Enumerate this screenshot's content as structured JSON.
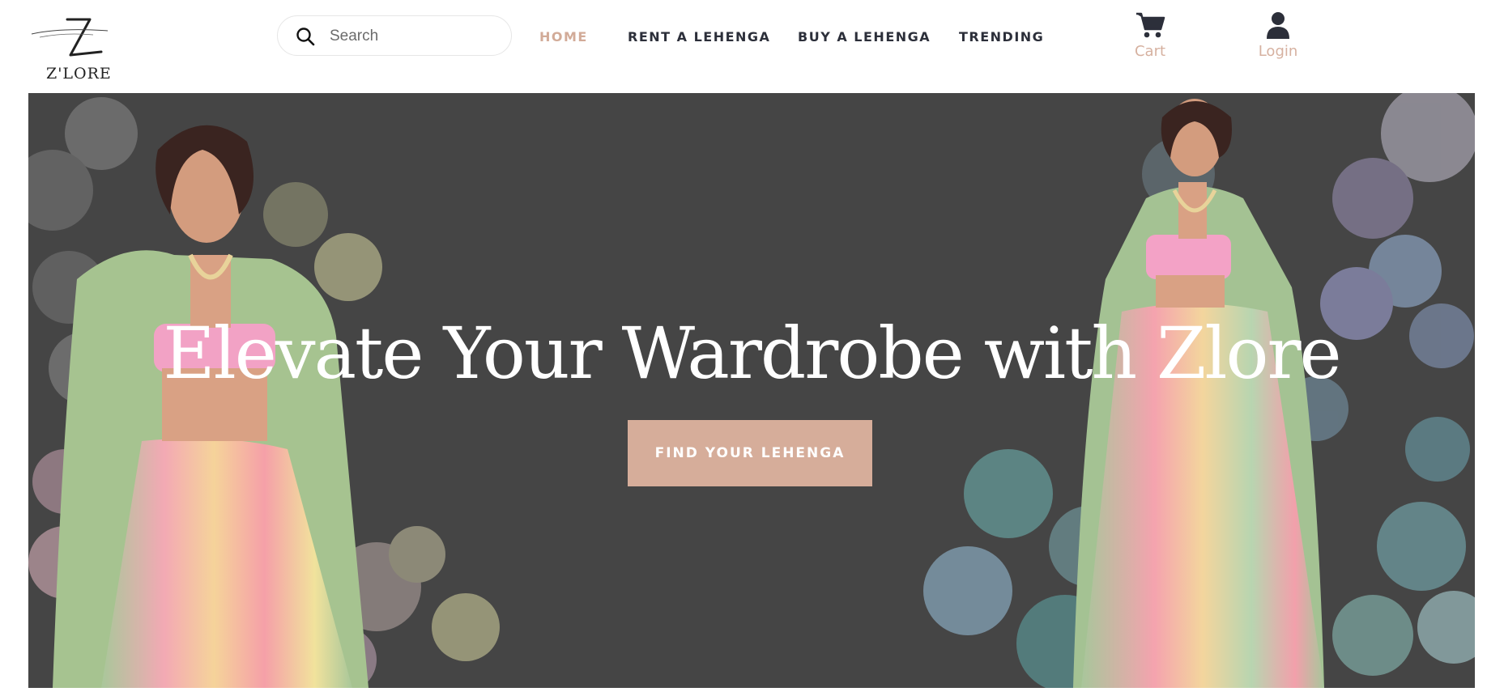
{
  "brand": {
    "name": "Z'LORE",
    "mark": "Z"
  },
  "search": {
    "placeholder": "Search"
  },
  "nav": {
    "items": [
      {
        "label": "HOME",
        "active": true
      },
      {
        "label": "RENT A LEHENGA",
        "active": false
      },
      {
        "label": "BUY A LEHENGA",
        "active": false
      },
      {
        "label": "TRENDING",
        "active": false
      }
    ]
  },
  "header_actions": {
    "cart": {
      "label": "Cart",
      "icon": "cart-icon"
    },
    "login": {
      "label": "Login",
      "icon": "user-icon"
    }
  },
  "hero": {
    "title": "Elevate Your Wardrobe with Zlore",
    "cta_label": "FIND YOUR LEHENGA",
    "images": [
      "model-left-lehenga-image",
      "model-right-lehenga-image"
    ]
  },
  "colors": {
    "accent": "#d2ab98",
    "nav_text": "#2c2f3a",
    "hero_bg": "#454545",
    "cta_bg": "#d6ad9a"
  }
}
